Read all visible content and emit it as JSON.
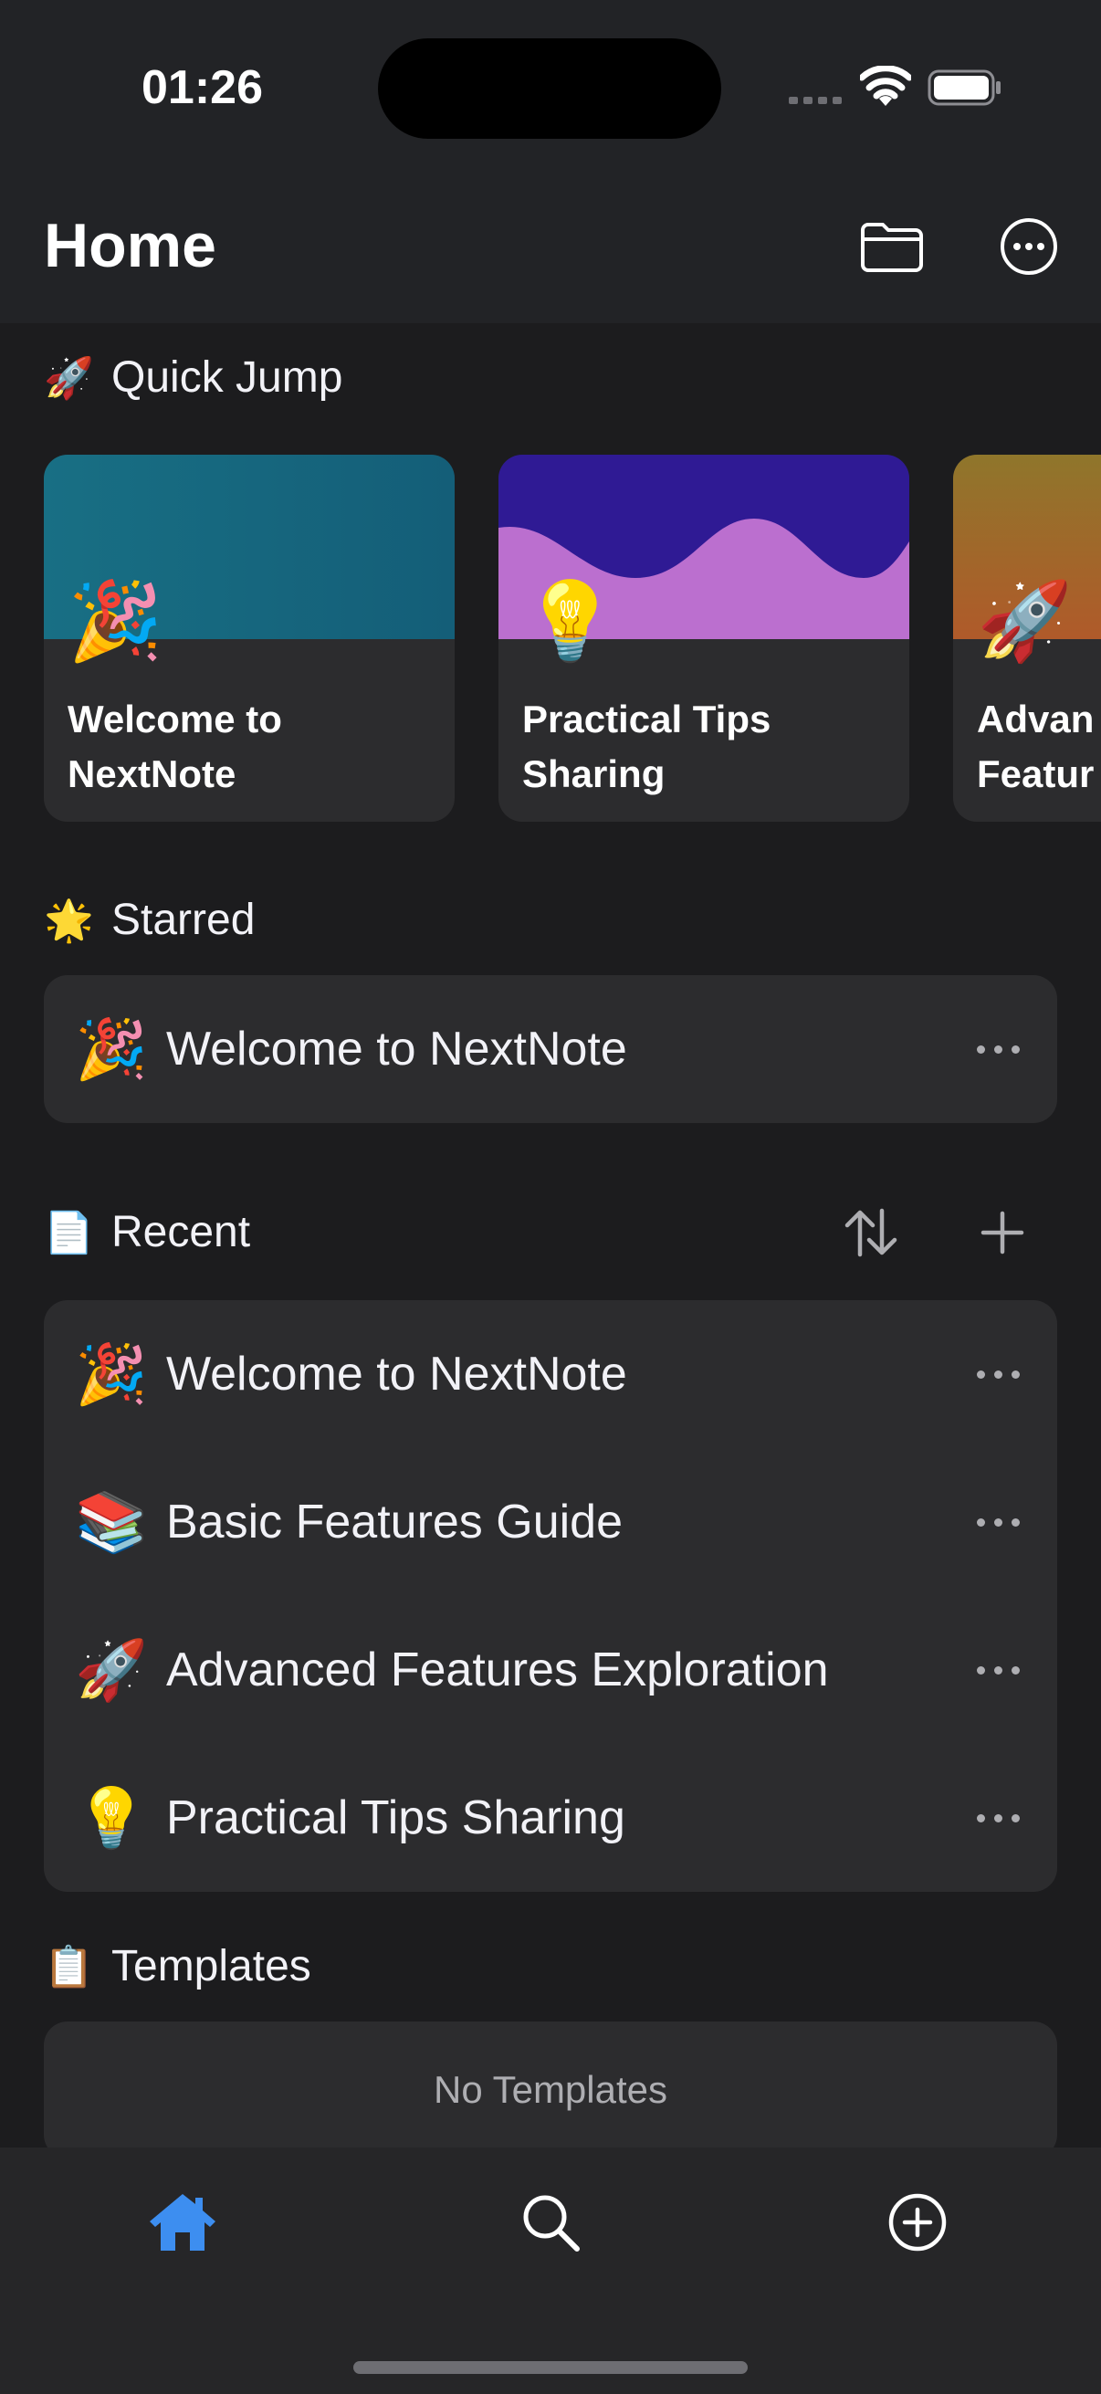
{
  "status_bar": {
    "time": "01:26"
  },
  "header": {
    "title": "Home",
    "folder_icon": "folder-icon",
    "more_icon": "ellipsis-circle-icon"
  },
  "quick_jump": {
    "emoji": "🚀",
    "title": "Quick Jump",
    "cards": [
      {
        "emoji": "🎉",
        "title": "Welcome to\nNextNote",
        "cover": "teal"
      },
      {
        "emoji": "💡",
        "title": "Practical Tips\nSharing",
        "cover": "purple-wave"
      },
      {
        "emoji": "🚀",
        "title": "Advan\nFeatur",
        "cover": "amber-gradient"
      }
    ]
  },
  "starred": {
    "emoji": "🌟",
    "title": "Starred",
    "items": [
      {
        "emoji": "🎉",
        "label": "Welcome to NextNote"
      }
    ]
  },
  "recent": {
    "emoji": "📄",
    "title": "Recent",
    "sort_icon": "sort-arrows-icon",
    "add_icon": "plus-icon",
    "items": [
      {
        "emoji": "🎉",
        "label": "Welcome to NextNote"
      },
      {
        "emoji": "📚",
        "label": "Basic Features Guide"
      },
      {
        "emoji": "🚀",
        "label": "Advanced Features Exploration"
      },
      {
        "emoji": "💡",
        "label": "Practical Tips Sharing"
      }
    ]
  },
  "templates": {
    "emoji": "📋",
    "title": "Templates",
    "empty_text": "No Templates"
  },
  "tab_bar": {
    "active": "home",
    "accent": "#3d8ef0",
    "tabs": [
      {
        "icon": "home-icon"
      },
      {
        "icon": "search-icon"
      },
      {
        "icon": "add-circle-icon"
      }
    ]
  }
}
